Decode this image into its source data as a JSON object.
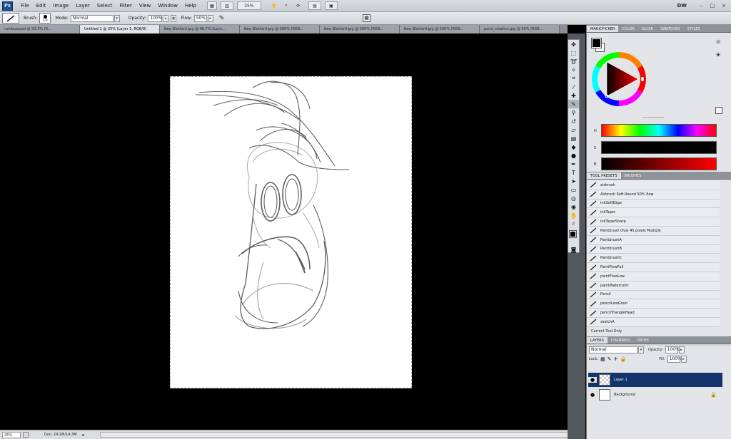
{
  "app": {
    "logo": "Ps",
    "menu": [
      "File",
      "Edit",
      "Image",
      "Layer",
      "Select",
      "Filter",
      "View",
      "Window",
      "Help"
    ],
    "zoom": "25%",
    "workspace": "DW",
    "window_controls": [
      "–",
      "□",
      "×"
    ]
  },
  "options": {
    "brush_label": "Brush:",
    "brush_size": "10",
    "mode_label": "Mode:",
    "mode_value": "Normal",
    "opacity_label": "Opacity:",
    "opacity_value": "100%",
    "flow_label": "Flow:",
    "flow_value": "50%"
  },
  "tabs": [
    {
      "label": "rainbow.psd @ 33.3% (R...",
      "active": false
    },
    {
      "label": "Untitled-1 @ 25% (Layer 1, RGB/8)",
      "active": true
    },
    {
      "label": "Bee_Blotter2.jpg @ 66.7% (Laye...",
      "active": false
    },
    {
      "label": "Bee_Blotter3.jpg @ 200% (RGB...",
      "active": false
    },
    {
      "label": "Bee_Blotter3.jpg @ 200% (RGB...",
      "active": false
    },
    {
      "label": "Bee_Blotter4.jpg @ 200% (RGB...",
      "active": false
    },
    {
      "label": "paint_rotation.jpg @ 50% (RGB...",
      "active": false
    }
  ],
  "status": {
    "zoom": "25%",
    "doc": "Doc: 24.1M/14.3M"
  },
  "color_panel": {
    "tabs": [
      "MAGICPICKER",
      "COLOR",
      "KULER",
      "SWATCHES",
      "STYLES"
    ],
    "h_label": "H",
    "s_label": "S",
    "b_label": "B"
  },
  "presets_panel": {
    "tabs": [
      "TOOL PRESETS",
      "BRUSHES"
    ],
    "items": [
      "airbrush",
      "Airbrush Soft Round 50% flow",
      "inkSoftEdge",
      "inkTaper",
      "inkTaperSharp",
      "Paintbrush Oval 45 pixels Multiply",
      "PaintbrushA",
      "PaintbrushB",
      "PaintbrushC",
      "PaintFlowFull",
      "paintFlowLow",
      "paintWatercolor",
      "Pencil",
      "pencilLowGrain",
      "pencilTriangleHead",
      "sketchA"
    ],
    "current_tool_only": "Current Tool Only"
  },
  "layers_panel": {
    "tabs": [
      "LAYERS",
      "CHANNELS",
      "PATHS"
    ],
    "blend_mode": "Normal",
    "opacity_label": "Opacity:",
    "opacity_value": "100%",
    "lock_label": "Lock:",
    "fill_label": "Fill:",
    "fill_value": "100%",
    "layers": [
      {
        "name": "Layer 1",
        "selected": true
      },
      {
        "name": "Background",
        "selected": false
      }
    ]
  },
  "colors": {
    "selection": "#14346e",
    "foreground": "#000000",
    "background": "#ffffff"
  }
}
